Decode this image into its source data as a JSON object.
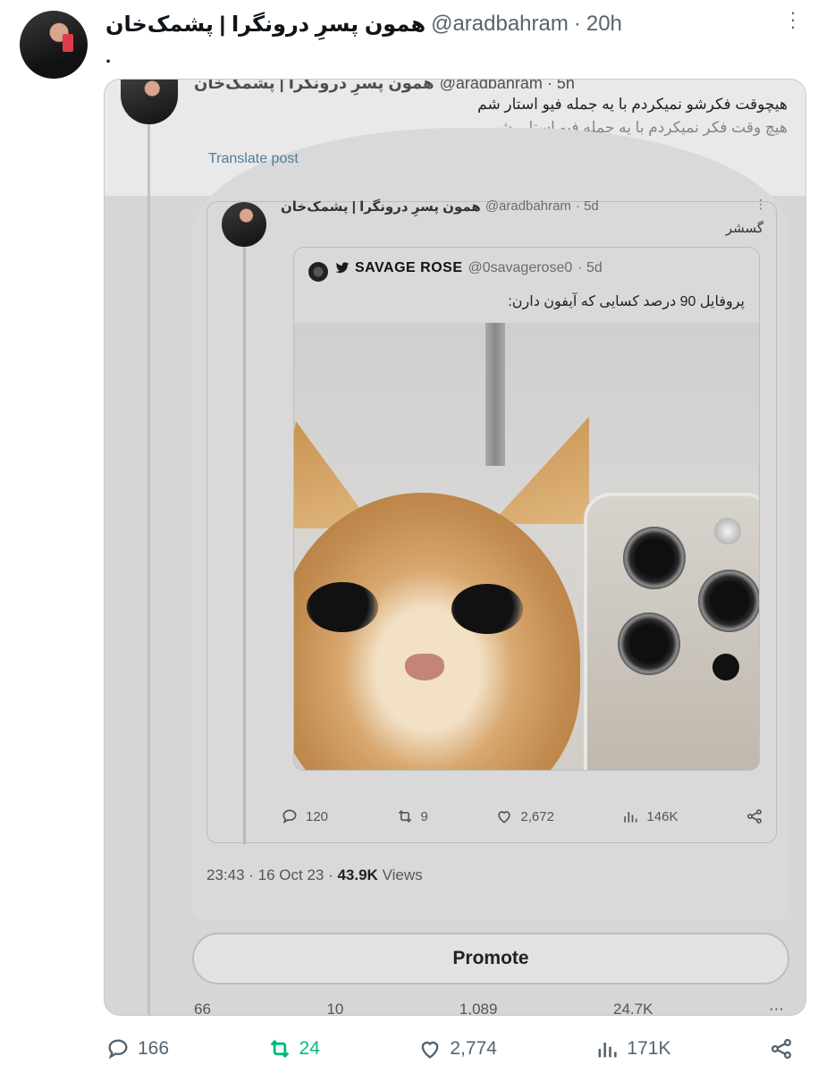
{
  "tweet": {
    "author_name": "همون پسرِ درونگرا | پشمک‌خان",
    "handle": "@aradbahram",
    "separator": "·",
    "time": "20h",
    "text": ".",
    "more_icon": "more-icon",
    "stats": {
      "replies": "166",
      "retweets": "24",
      "likes": "2,774",
      "views": "171K"
    },
    "retweet_color": "#00ba7c"
  },
  "screenshot": {
    "header_name": "همون پسرِ درونگرا | پشمک‌خان",
    "header_handle": "@aradbahram · 5h",
    "line1": "هیچوقت فکرشو نمیکردم با یه جمله فیو استار شم",
    "line2": "هیچ وقت فکر نمیکردم با یه جمله فیو استار بشم",
    "translate": "Translate post",
    "quote": {
      "name": "همون پسرِ درونگرا | پشمک‌خان",
      "handle": "@aradbahram",
      "time": "· 5d",
      "text": "گسشر",
      "nested": {
        "name": "SAVAGE ROSE",
        "handle": "@0savagerose0",
        "time": "· 5d",
        "text": "پروفایل 90 درصد کسایی که آیفون دارن:",
        "image_alt": "kitten next to iPhone camera"
      },
      "stats": {
        "replies": "120",
        "retweets": "9",
        "likes": "2,672",
        "views": "146K"
      }
    },
    "meta_time": "23:43 · 16 Oct 23 · ",
    "meta_views_count": "43.9K",
    "meta_views_label": " Views",
    "promote": "Promote",
    "stats": {
      "replies": "66",
      "retweets": "10",
      "likes": "1,089",
      "views": "24.7K"
    }
  }
}
